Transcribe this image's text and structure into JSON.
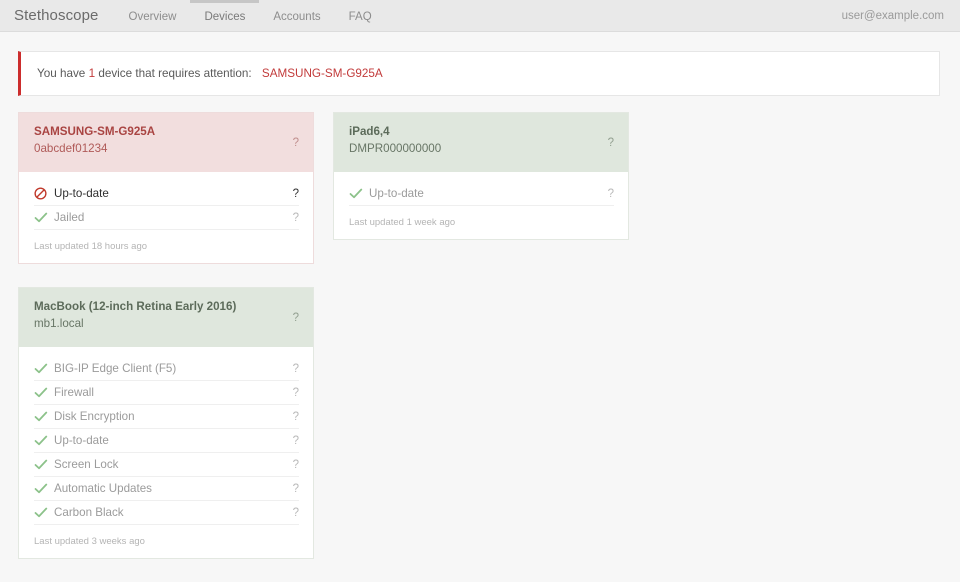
{
  "navbar": {
    "brand": "Stethoscope",
    "links": [
      {
        "label": "Overview",
        "active": false
      },
      {
        "label": "Devices",
        "active": true
      },
      {
        "label": "Accounts",
        "active": false
      },
      {
        "label": "FAQ",
        "active": false
      }
    ],
    "user_email": "user@example.com"
  },
  "alert": {
    "prefix": "You have ",
    "count": "1",
    "middle": " device that requires attention: ",
    "device_link": "SAMSUNG-SM-G925A",
    "accent_color": "#cc2d2d"
  },
  "help_glyph": "?",
  "cards": [
    {
      "name": "SAMSUNG-SM-G925A",
      "identifier": "0abcdef01234",
      "status": "danger",
      "header_color": "#f2dede",
      "checks": [
        {
          "label": "Up-to-date",
          "icon": "prohibited-icon",
          "state": "fail",
          "help": "?"
        },
        {
          "label": "Jailed",
          "icon": "check-icon",
          "state": "pass",
          "help": "?"
        }
      ],
      "updated": "Last updated 18 hours ago",
      "help": "?"
    },
    {
      "name": "iPad6,4",
      "identifier": "DMPR000000000",
      "status": "ok",
      "header_color": "#dfe7dd",
      "checks": [
        {
          "label": "Up-to-date",
          "icon": "check-icon",
          "state": "pass",
          "help": "?"
        }
      ],
      "updated": "Last updated 1 week ago",
      "help": "?"
    },
    {
      "name": "MacBook (12-inch Retina Early 2016)",
      "identifier": "mb1.local",
      "status": "ok",
      "header_color": "#dfe7dd",
      "checks": [
        {
          "label": "BIG-IP Edge Client (F5)",
          "icon": "check-icon",
          "state": "pass",
          "help": "?"
        },
        {
          "label": "Firewall",
          "icon": "check-icon",
          "state": "pass",
          "help": "?"
        },
        {
          "label": "Disk Encryption",
          "icon": "check-icon",
          "state": "pass",
          "help": "?"
        },
        {
          "label": "Up-to-date",
          "icon": "check-icon",
          "state": "pass",
          "help": "?"
        },
        {
          "label": "Screen Lock",
          "icon": "check-icon",
          "state": "pass",
          "help": "?"
        },
        {
          "label": "Automatic Updates",
          "icon": "check-icon",
          "state": "pass",
          "help": "?"
        },
        {
          "label": "Carbon Black",
          "icon": "check-icon",
          "state": "pass",
          "help": "?"
        }
      ],
      "updated": "Last updated 3 weeks ago",
      "help": "?"
    }
  ],
  "layout": {
    "column_1_card_indexes": [
      0,
      2
    ],
    "column_2_card_indexes": [
      1
    ]
  }
}
